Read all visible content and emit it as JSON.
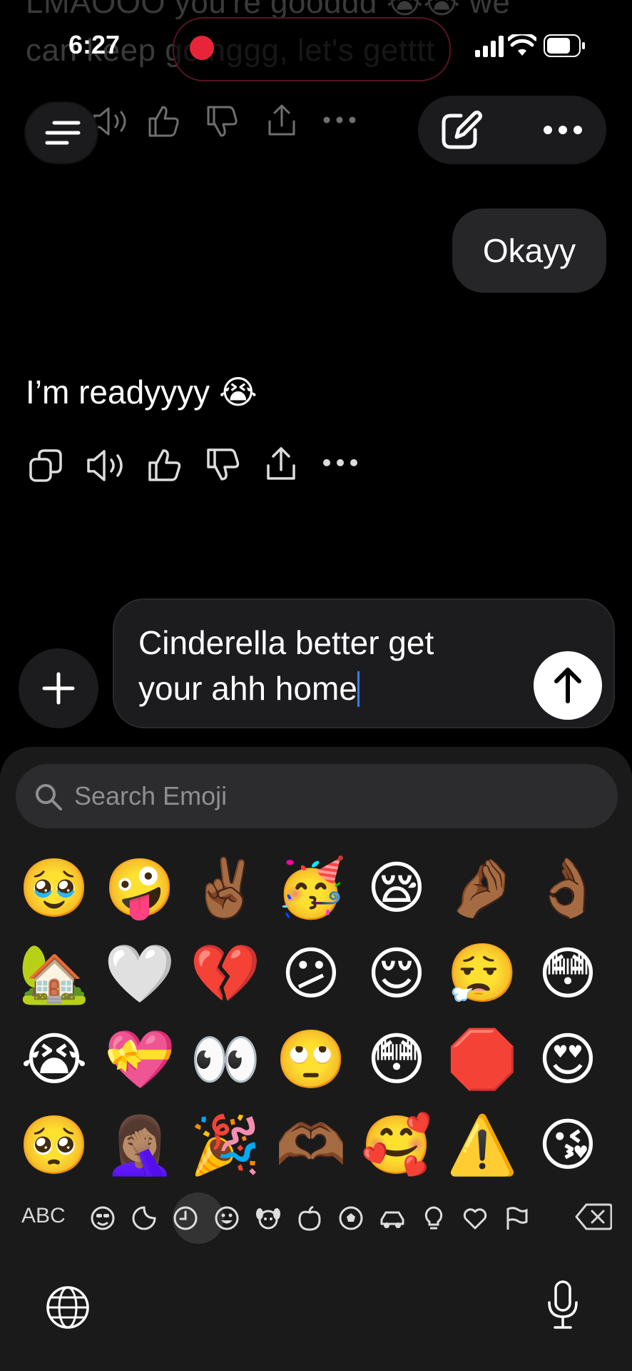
{
  "status_bar": {
    "time": "6:27"
  },
  "previous_message": {
    "line1": "LMAOOO you're gooddd 😭😭 we",
    "line2": "can keep goinggg, let's getttt"
  },
  "header": {
    "menu_icon": "hamburger-icon",
    "new_chat_icon": "compose-icon",
    "more_icon": "ellipsis-icon"
  },
  "conversation": {
    "user_message": "Okayy",
    "assistant_message": "I’m readyyyy 😭",
    "action_icons": [
      "copy-icon",
      "speaker-icon",
      "thumbs-up-icon",
      "thumbs-down-icon",
      "share-icon",
      "more-icon"
    ]
  },
  "composer": {
    "text_line1": "Cinderella better get",
    "text_line2": "your ahh home",
    "plus_icon": "plus-icon",
    "send_icon": "arrow-up-icon"
  },
  "keyboard": {
    "search_placeholder": "Search Emoji",
    "emoji_rows": [
      [
        "🥹",
        "🤪",
        "✌🏾",
        "🥳",
        "😪",
        "🤌🏾",
        "👌🏾"
      ],
      [
        "🏡",
        "🤍",
        "💔",
        "😕",
        "😌",
        "😮‍💨",
        "😳"
      ],
      [
        "😭",
        "💝",
        "👀",
        "🙄",
        "😳",
        "🛑",
        "😍"
      ],
      [
        "🥺",
        "🤦🏽‍♀️",
        "🎉",
        "🫶🏾",
        "🥰",
        "⚠️",
        "😘"
      ]
    ],
    "abc_label": "ABC",
    "categories": [
      "smileys-icon",
      "stickers-icon",
      "recent-icon",
      "smiley-icon",
      "animals-icon",
      "food-icon",
      "sports-icon",
      "travel-icon",
      "objects-icon",
      "symbols-icon",
      "flags-icon"
    ],
    "selected_category": "recent-icon",
    "delete_icon": "backspace-icon",
    "globe_icon": "globe-icon",
    "mic_icon": "microphone-icon"
  }
}
